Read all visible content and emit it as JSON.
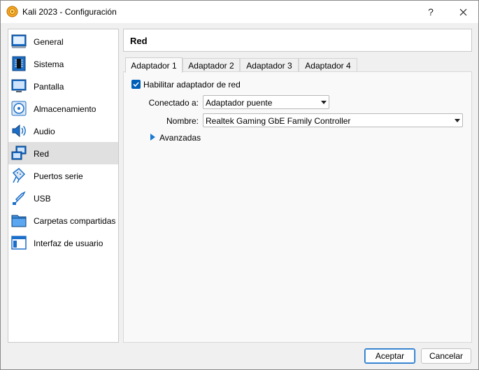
{
  "window": {
    "title": "Kali 2023 - Configuración",
    "help_label": "?",
    "close_label": "✕"
  },
  "sidebar": {
    "items": [
      {
        "label": "General",
        "icon": "general-icon"
      },
      {
        "label": "Sistema",
        "icon": "system-chip-icon"
      },
      {
        "label": "Pantalla",
        "icon": "display-monitor-icon"
      },
      {
        "label": "Almacenamiento",
        "icon": "storage-disc-icon"
      },
      {
        "label": "Audio",
        "icon": "audio-speaker-icon"
      },
      {
        "label": "Red",
        "icon": "network-icon"
      },
      {
        "label": "Puertos serie",
        "icon": "serial-port-icon"
      },
      {
        "label": "USB",
        "icon": "usb-icon"
      },
      {
        "label": "Carpetas compartidas",
        "icon": "shared-folder-icon"
      },
      {
        "label": "Interfaz de usuario",
        "icon": "user-interface-icon"
      }
    ],
    "selected": "Red"
  },
  "header": {
    "title": "Red"
  },
  "tabs": [
    {
      "label": "Adaptador 1",
      "active": true
    },
    {
      "label": "Adaptador 2",
      "active": false
    },
    {
      "label": "Adaptador 3",
      "active": false
    },
    {
      "label": "Adaptador 4",
      "active": false
    }
  ],
  "adapter": {
    "enable_label": "Habilitar adaptador de red",
    "enabled": true,
    "connected_label": "Conectado a:",
    "connected_value": "Adaptador puente",
    "name_label": "Nombre:",
    "name_value": "Realtek Gaming GbE Family Controller",
    "advanced_label": "Avanzadas"
  },
  "buttons": {
    "accept": "Aceptar",
    "cancel": "Cancelar"
  },
  "colors": {
    "accent": "#005fb8",
    "selected_row": "#e0e0e0"
  }
}
